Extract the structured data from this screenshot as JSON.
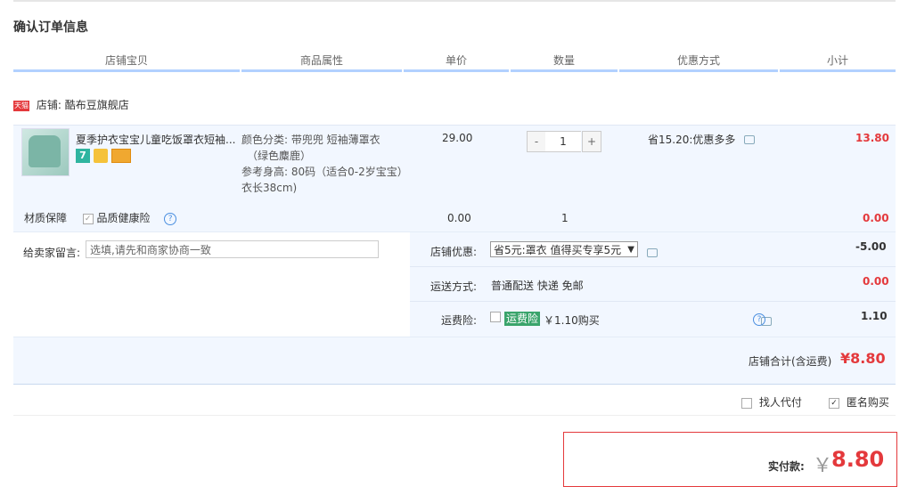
{
  "page": {
    "title": "确认订单信息"
  },
  "table": {
    "headers": [
      "店铺宝贝",
      "商品属性",
      "单价",
      "数量",
      "优惠方式",
      "小计"
    ]
  },
  "shop": {
    "badge": "天猫",
    "label": "店铺:",
    "name": "酷布豆旗舰店"
  },
  "item": {
    "name": "夏季护衣宝宝儿童吃饭罩衣短袖...",
    "attr_lines": [
      "颜色分类: 带兜兜 短袖薄罩衣",
      "（绿色麋鹿）",
      "参考身高: 80码（适合0-2岁宝宝）",
      "衣长38cm)"
    ],
    "price": "29.00",
    "qty": "1",
    "qty_minus": "-",
    "qty_plus": "+",
    "discount": "省15.20:优惠多多",
    "subtotal": "13.80",
    "icons": [
      "seven-day-return-icon",
      "guarantee-icon",
      "card-pay-icon"
    ],
    "badge_7": "7"
  },
  "insurance": {
    "label": "材质保障",
    "option": "品质健康险",
    "price": "0.00",
    "qty": "1",
    "subtotal": "0.00"
  },
  "message": {
    "label": "给卖家留言:",
    "placeholder": "选填,请先和商家协商一致"
  },
  "shop_discount": {
    "label": "店铺优惠:",
    "selected": "省5元:罩衣 值得买专享5元",
    "value": "-5.00"
  },
  "shipping": {
    "label": "运送方式:",
    "method": "普通配送 快递 免邮",
    "value": "0.00"
  },
  "freight_insurance": {
    "label": "运费险:",
    "badge": "运费险",
    "price": "￥1.10购买",
    "value": "1.10"
  },
  "shop_total": {
    "label": "店铺合计(含运费)",
    "value": "¥8.80"
  },
  "options": {
    "proxy_pay": "找人代付",
    "anonymous": "匿名购买",
    "anonymous_checked": true,
    "proxy_checked": false
  },
  "payment": {
    "label": "实付款:",
    "currency": "￥",
    "value": "8.80"
  },
  "colors": {
    "accent": "#e4393c",
    "header_line": "#b2d1ff",
    "row_bg": "#f2f7ff"
  }
}
